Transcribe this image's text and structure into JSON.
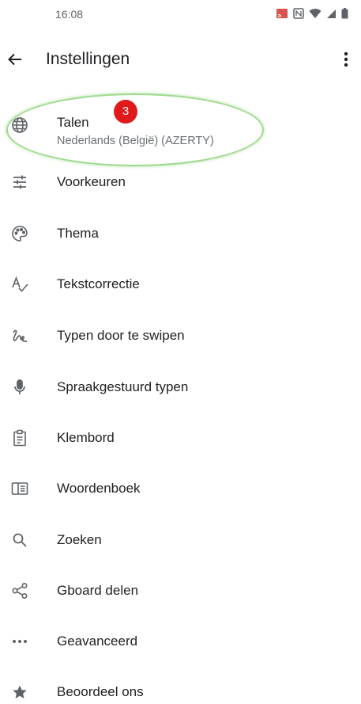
{
  "status_bar": {
    "time": "16:08",
    "icons": [
      "cast-icon",
      "nfc-icon",
      "wifi-icon",
      "signal-icon",
      "battery-icon"
    ]
  },
  "app_bar": {
    "title": "Instellingen",
    "back_icon": "arrow-back-icon",
    "more_icon": "more-vert-icon"
  },
  "annotation": {
    "badge_number": "3",
    "badge_color": "#e0191b",
    "highlight_color": "#9ed98c"
  },
  "settings": [
    {
      "label": "Talen",
      "sub": "Nederlands (België) (AZERTY)",
      "icon": "globe-icon"
    },
    {
      "label": "Voorkeuren",
      "icon": "tune-icon"
    },
    {
      "label": "Thema",
      "icon": "palette-icon"
    },
    {
      "label": "Tekstcorrectie",
      "icon": "spellcheck-icon"
    },
    {
      "label": "Typen door te swipen",
      "icon": "gesture-icon"
    },
    {
      "label": "Spraakgestuurd typen",
      "icon": "mic-icon"
    },
    {
      "label": "Klembord",
      "icon": "clipboard-icon"
    },
    {
      "label": "Woordenboek",
      "icon": "dictionary-icon"
    },
    {
      "label": "Zoeken",
      "icon": "search-icon"
    },
    {
      "label": "Gboard delen",
      "icon": "share-icon"
    },
    {
      "label": "Geavanceerd",
      "icon": "more-horiz-icon"
    },
    {
      "label": "Beoordeel ons",
      "icon": "star-icon"
    }
  ]
}
